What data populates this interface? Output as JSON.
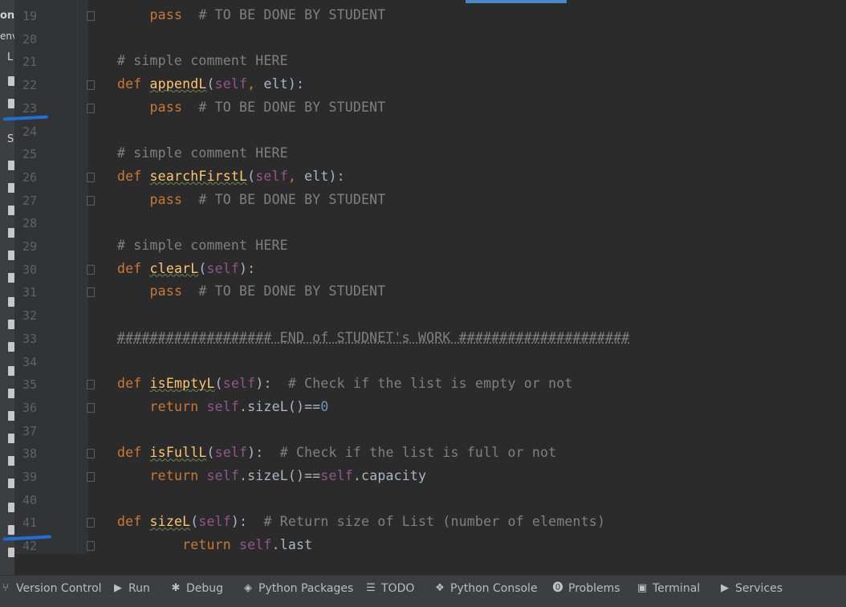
{
  "left_panel": {
    "labels": [
      "on",
      "env",
      "L",
      "S"
    ]
  },
  "editor": {
    "lines": [
      {
        "n": "19",
        "tokens": [
          {
            "t": "    "
          },
          {
            "t": "pass",
            "c": "kw"
          },
          {
            "t": "  # TO BE DONE BY STUDENT",
            "c": "cm"
          }
        ]
      },
      {
        "n": "20",
        "tokens": []
      },
      {
        "n": "21",
        "tokens": [
          {
            "t": "# simple comment HERE",
            "c": "cm"
          }
        ]
      },
      {
        "n": "22",
        "tokens": [
          {
            "t": "def ",
            "c": "kw"
          },
          {
            "t": "appendL",
            "c": "fn"
          },
          {
            "t": "("
          },
          {
            "t": "self",
            "c": "self"
          },
          {
            "t": ", ",
            "c": "kw"
          },
          {
            "t": "elt):"
          }
        ]
      },
      {
        "n": "23",
        "tokens": [
          {
            "t": "    "
          },
          {
            "t": "pass",
            "c": "kw"
          },
          {
            "t": "  # TO BE DONE BY STUDENT",
            "c": "cm"
          }
        ]
      },
      {
        "n": "24",
        "tokens": []
      },
      {
        "n": "25",
        "tokens": [
          {
            "t": "# simple comment HERE",
            "c": "cm"
          }
        ]
      },
      {
        "n": "26",
        "tokens": [
          {
            "t": "def ",
            "c": "kw"
          },
          {
            "t": "searchFirstL",
            "c": "fn"
          },
          {
            "t": "("
          },
          {
            "t": "self",
            "c": "self"
          },
          {
            "t": ", ",
            "c": "kw"
          },
          {
            "t": "elt):"
          }
        ]
      },
      {
        "n": "27",
        "tokens": [
          {
            "t": "    "
          },
          {
            "t": "pass",
            "c": "kw"
          },
          {
            "t": "  # TO BE DONE BY STUDENT",
            "c": "cm"
          }
        ]
      },
      {
        "n": "28",
        "tokens": []
      },
      {
        "n": "29",
        "tokens": [
          {
            "t": "# simple comment HERE",
            "c": "cm"
          }
        ]
      },
      {
        "n": "30",
        "tokens": [
          {
            "t": "def ",
            "c": "kw"
          },
          {
            "t": "clearL",
            "c": "fn"
          },
          {
            "t": "("
          },
          {
            "t": "self",
            "c": "self"
          },
          {
            "t": "):"
          }
        ]
      },
      {
        "n": "31",
        "tokens": [
          {
            "t": "    "
          },
          {
            "t": "pass",
            "c": "kw"
          },
          {
            "t": "  # TO BE DONE BY STUDENT",
            "c": "cm"
          }
        ]
      },
      {
        "n": "32",
        "tokens": []
      },
      {
        "n": "33",
        "tokens": [
          {
            "t": "################### END of STUDNET's WORK #####################",
            "c": "sep"
          }
        ]
      },
      {
        "n": "34",
        "tokens": []
      },
      {
        "n": "35",
        "tokens": [
          {
            "t": "def ",
            "c": "kw"
          },
          {
            "t": "isEmptyL",
            "c": "fn"
          },
          {
            "t": "("
          },
          {
            "t": "self",
            "c": "self"
          },
          {
            "t": "):"
          },
          {
            "t": "  # Check if the list is empty or not",
            "c": "cm"
          }
        ]
      },
      {
        "n": "36",
        "tokens": [
          {
            "t": "    "
          },
          {
            "t": "return ",
            "c": "kw"
          },
          {
            "t": "self",
            "c": "self"
          },
          {
            "t": ".sizeL()=="
          },
          {
            "t": "0",
            "c": "num"
          }
        ]
      },
      {
        "n": "37",
        "tokens": []
      },
      {
        "n": "38",
        "tokens": [
          {
            "t": "def ",
            "c": "kw"
          },
          {
            "t": "isFullL",
            "c": "fn"
          },
          {
            "t": "("
          },
          {
            "t": "self",
            "c": "self"
          },
          {
            "t": "):"
          },
          {
            "t": "  # Check if the list is full or not",
            "c": "cm"
          }
        ]
      },
      {
        "n": "39",
        "tokens": [
          {
            "t": "    "
          },
          {
            "t": "return ",
            "c": "kw"
          },
          {
            "t": "self",
            "c": "self"
          },
          {
            "t": ".sizeL()=="
          },
          {
            "t": "self",
            "c": "self"
          },
          {
            "t": ".capacity"
          }
        ]
      },
      {
        "n": "40",
        "tokens": []
      },
      {
        "n": "41",
        "tokens": [
          {
            "t": "def ",
            "c": "kw"
          },
          {
            "t": "sizeL",
            "c": "fn"
          },
          {
            "t": "("
          },
          {
            "t": "self",
            "c": "self"
          },
          {
            "t": "):"
          },
          {
            "t": "  # Return size of List (number of elements)",
            "c": "cm"
          }
        ]
      },
      {
        "n": "42",
        "tokens": [
          {
            "t": "        "
          },
          {
            "t": "return ",
            "c": "kw"
          },
          {
            "t": "self",
            "c": "self"
          },
          {
            "t": ".last"
          }
        ]
      }
    ],
    "fold_markers": [
      "19",
      "22",
      "23",
      "26",
      "27",
      "30",
      "31",
      "35",
      "36",
      "38",
      "39",
      "41",
      "42"
    ]
  },
  "toolbar": {
    "items": [
      {
        "label": "Version Control",
        "icon": "branch-icon"
      },
      {
        "label": "Run",
        "icon": "run-icon"
      },
      {
        "label": "Debug",
        "icon": "bug-icon"
      },
      {
        "label": "Python Packages",
        "icon": "packages-icon"
      },
      {
        "label": "TODO",
        "icon": "list-icon"
      },
      {
        "label": "Python Console",
        "icon": "python-icon"
      },
      {
        "label": "Problems",
        "icon": "warning-icon"
      },
      {
        "label": "Terminal",
        "icon": "terminal-icon"
      },
      {
        "label": "Services",
        "icon": "services-icon"
      }
    ]
  },
  "colors": {
    "background": "#2b2b2b",
    "keyword": "#cc7832",
    "function": "#ffc66d",
    "self": "#94558d",
    "comment": "#808080",
    "number": "#6897bb",
    "annotation_marks": "#1f6fd6"
  }
}
